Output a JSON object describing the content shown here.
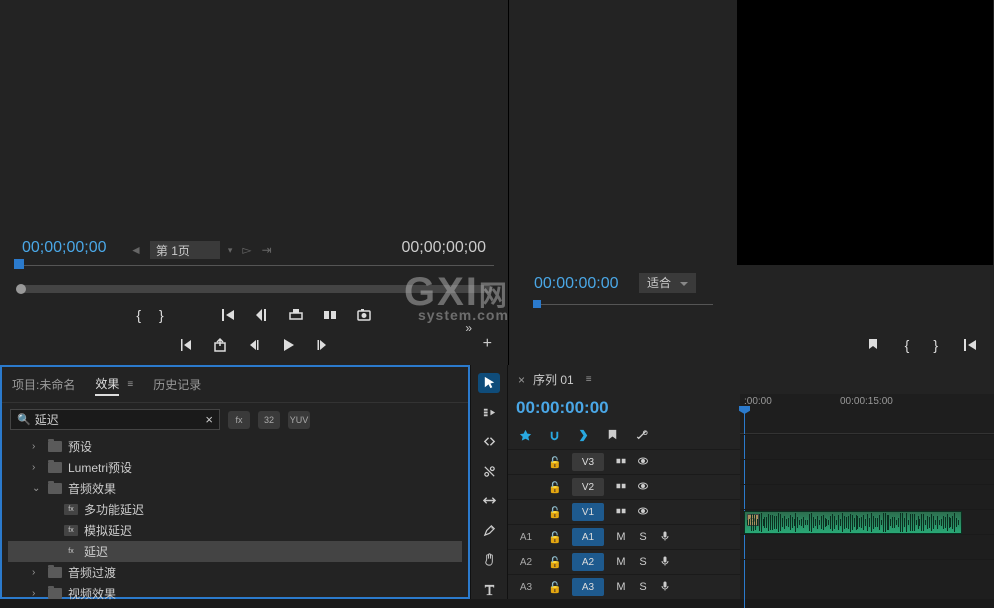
{
  "watermark": {
    "main": "GXI",
    "sub": "system.com",
    "suffix": "网"
  },
  "source": {
    "timecode_left": "00;00;00;00",
    "timecode_right": "00;00;00;00",
    "page_label": "第 1页"
  },
  "program": {
    "timecode": "00:00:00:00",
    "zoom": "适合"
  },
  "effects_panel": {
    "tabs": {
      "project": "项目:未命名",
      "effects": "效果",
      "history": "历史记录"
    },
    "search_value": "延迟",
    "filters": [
      "fx",
      "32",
      "YUV"
    ],
    "tree": [
      {
        "label": "预设",
        "type": "folder",
        "level": 1,
        "expand": "›"
      },
      {
        "label": "Lumetri预设",
        "type": "folder",
        "level": 1,
        "expand": "›"
      },
      {
        "label": "音频效果",
        "type": "folder",
        "level": 1,
        "expand": "⌄"
      },
      {
        "label": "多功能延迟",
        "type": "fx",
        "level": 2,
        "expand": ""
      },
      {
        "label": "模拟延迟",
        "type": "fx",
        "level": 2,
        "expand": ""
      },
      {
        "label": "延迟",
        "type": "fx",
        "level": 2,
        "expand": "",
        "selected": true
      },
      {
        "label": "音频过渡",
        "type": "folder",
        "level": 1,
        "expand": "›"
      },
      {
        "label": "视频效果",
        "type": "folder",
        "level": 1,
        "expand": "›"
      }
    ]
  },
  "timeline": {
    "sequence_name": "序列 01",
    "timecode": "00:00:00:00",
    "ruler": [
      {
        "label": ":00:00",
        "pos": 4
      },
      {
        "label": "00:00:15:00",
        "pos": 100
      }
    ],
    "video_tracks": [
      {
        "src": "",
        "name": "V3"
      },
      {
        "src": "",
        "name": "V2"
      },
      {
        "src": "",
        "name": "V1",
        "target": true
      }
    ],
    "audio_tracks": [
      {
        "src": "A1",
        "name": "A1",
        "target": true,
        "has_clip": true
      },
      {
        "src": "A2",
        "name": "A2",
        "target": true
      },
      {
        "src": "A3",
        "name": "A3",
        "target": true
      }
    ],
    "track_buttons": {
      "m": "M",
      "s": "S"
    }
  }
}
